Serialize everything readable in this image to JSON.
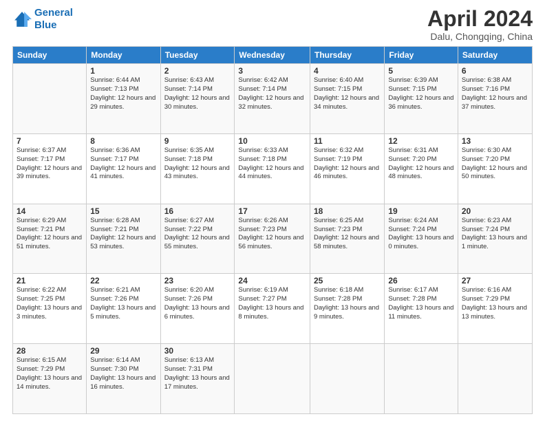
{
  "logo": {
    "line1": "General",
    "line2": "Blue"
  },
  "title": "April 2024",
  "subtitle": "Dalu, Chongqing, China",
  "days_of_week": [
    "Sunday",
    "Monday",
    "Tuesday",
    "Wednesday",
    "Thursday",
    "Friday",
    "Saturday"
  ],
  "weeks": [
    [
      {
        "day": "",
        "sunrise": "",
        "sunset": "",
        "daylight": ""
      },
      {
        "day": "1",
        "sunrise": "Sunrise: 6:44 AM",
        "sunset": "Sunset: 7:13 PM",
        "daylight": "Daylight: 12 hours and 29 minutes."
      },
      {
        "day": "2",
        "sunrise": "Sunrise: 6:43 AM",
        "sunset": "Sunset: 7:14 PM",
        "daylight": "Daylight: 12 hours and 30 minutes."
      },
      {
        "day": "3",
        "sunrise": "Sunrise: 6:42 AM",
        "sunset": "Sunset: 7:14 PM",
        "daylight": "Daylight: 12 hours and 32 minutes."
      },
      {
        "day": "4",
        "sunrise": "Sunrise: 6:40 AM",
        "sunset": "Sunset: 7:15 PM",
        "daylight": "Daylight: 12 hours and 34 minutes."
      },
      {
        "day": "5",
        "sunrise": "Sunrise: 6:39 AM",
        "sunset": "Sunset: 7:15 PM",
        "daylight": "Daylight: 12 hours and 36 minutes."
      },
      {
        "day": "6",
        "sunrise": "Sunrise: 6:38 AM",
        "sunset": "Sunset: 7:16 PM",
        "daylight": "Daylight: 12 hours and 37 minutes."
      }
    ],
    [
      {
        "day": "7",
        "sunrise": "Sunrise: 6:37 AM",
        "sunset": "Sunset: 7:17 PM",
        "daylight": "Daylight: 12 hours and 39 minutes."
      },
      {
        "day": "8",
        "sunrise": "Sunrise: 6:36 AM",
        "sunset": "Sunset: 7:17 PM",
        "daylight": "Daylight: 12 hours and 41 minutes."
      },
      {
        "day": "9",
        "sunrise": "Sunrise: 6:35 AM",
        "sunset": "Sunset: 7:18 PM",
        "daylight": "Daylight: 12 hours and 43 minutes."
      },
      {
        "day": "10",
        "sunrise": "Sunrise: 6:33 AM",
        "sunset": "Sunset: 7:18 PM",
        "daylight": "Daylight: 12 hours and 44 minutes."
      },
      {
        "day": "11",
        "sunrise": "Sunrise: 6:32 AM",
        "sunset": "Sunset: 7:19 PM",
        "daylight": "Daylight: 12 hours and 46 minutes."
      },
      {
        "day": "12",
        "sunrise": "Sunrise: 6:31 AM",
        "sunset": "Sunset: 7:20 PM",
        "daylight": "Daylight: 12 hours and 48 minutes."
      },
      {
        "day": "13",
        "sunrise": "Sunrise: 6:30 AM",
        "sunset": "Sunset: 7:20 PM",
        "daylight": "Daylight: 12 hours and 50 minutes."
      }
    ],
    [
      {
        "day": "14",
        "sunrise": "Sunrise: 6:29 AM",
        "sunset": "Sunset: 7:21 PM",
        "daylight": "Daylight: 12 hours and 51 minutes."
      },
      {
        "day": "15",
        "sunrise": "Sunrise: 6:28 AM",
        "sunset": "Sunset: 7:21 PM",
        "daylight": "Daylight: 12 hours and 53 minutes."
      },
      {
        "day": "16",
        "sunrise": "Sunrise: 6:27 AM",
        "sunset": "Sunset: 7:22 PM",
        "daylight": "Daylight: 12 hours and 55 minutes."
      },
      {
        "day": "17",
        "sunrise": "Sunrise: 6:26 AM",
        "sunset": "Sunset: 7:23 PM",
        "daylight": "Daylight: 12 hours and 56 minutes."
      },
      {
        "day": "18",
        "sunrise": "Sunrise: 6:25 AM",
        "sunset": "Sunset: 7:23 PM",
        "daylight": "Daylight: 12 hours and 58 minutes."
      },
      {
        "day": "19",
        "sunrise": "Sunrise: 6:24 AM",
        "sunset": "Sunset: 7:24 PM",
        "daylight": "Daylight: 13 hours and 0 minutes."
      },
      {
        "day": "20",
        "sunrise": "Sunrise: 6:23 AM",
        "sunset": "Sunset: 7:24 PM",
        "daylight": "Daylight: 13 hours and 1 minute."
      }
    ],
    [
      {
        "day": "21",
        "sunrise": "Sunrise: 6:22 AM",
        "sunset": "Sunset: 7:25 PM",
        "daylight": "Daylight: 13 hours and 3 minutes."
      },
      {
        "day": "22",
        "sunrise": "Sunrise: 6:21 AM",
        "sunset": "Sunset: 7:26 PM",
        "daylight": "Daylight: 13 hours and 5 minutes."
      },
      {
        "day": "23",
        "sunrise": "Sunrise: 6:20 AM",
        "sunset": "Sunset: 7:26 PM",
        "daylight": "Daylight: 13 hours and 6 minutes."
      },
      {
        "day": "24",
        "sunrise": "Sunrise: 6:19 AM",
        "sunset": "Sunset: 7:27 PM",
        "daylight": "Daylight: 13 hours and 8 minutes."
      },
      {
        "day": "25",
        "sunrise": "Sunrise: 6:18 AM",
        "sunset": "Sunset: 7:28 PM",
        "daylight": "Daylight: 13 hours and 9 minutes."
      },
      {
        "day": "26",
        "sunrise": "Sunrise: 6:17 AM",
        "sunset": "Sunset: 7:28 PM",
        "daylight": "Daylight: 13 hours and 11 minutes."
      },
      {
        "day": "27",
        "sunrise": "Sunrise: 6:16 AM",
        "sunset": "Sunset: 7:29 PM",
        "daylight": "Daylight: 13 hours and 13 minutes."
      }
    ],
    [
      {
        "day": "28",
        "sunrise": "Sunrise: 6:15 AM",
        "sunset": "Sunset: 7:29 PM",
        "daylight": "Daylight: 13 hours and 14 minutes."
      },
      {
        "day": "29",
        "sunrise": "Sunrise: 6:14 AM",
        "sunset": "Sunset: 7:30 PM",
        "daylight": "Daylight: 13 hours and 16 minutes."
      },
      {
        "day": "30",
        "sunrise": "Sunrise: 6:13 AM",
        "sunset": "Sunset: 7:31 PM",
        "daylight": "Daylight: 13 hours and 17 minutes."
      },
      {
        "day": "",
        "sunrise": "",
        "sunset": "",
        "daylight": ""
      },
      {
        "day": "",
        "sunrise": "",
        "sunset": "",
        "daylight": ""
      },
      {
        "day": "",
        "sunrise": "",
        "sunset": "",
        "daylight": ""
      },
      {
        "day": "",
        "sunrise": "",
        "sunset": "",
        "daylight": ""
      }
    ]
  ]
}
